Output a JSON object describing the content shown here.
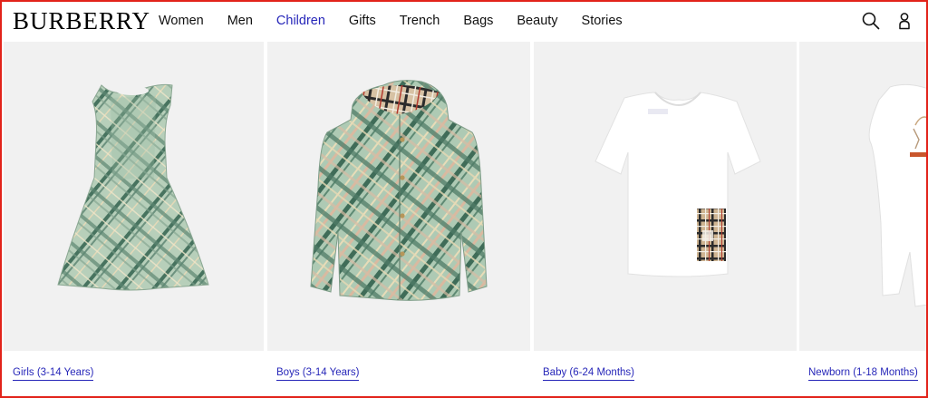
{
  "brand": {
    "logo": "BURBERRY"
  },
  "nav": {
    "items": [
      {
        "label": "Women",
        "active": false
      },
      {
        "label": "Men",
        "active": false
      },
      {
        "label": "Children",
        "active": true
      },
      {
        "label": "Gifts",
        "active": false
      },
      {
        "label": "Trench",
        "active": false
      },
      {
        "label": "Bags",
        "active": false
      },
      {
        "label": "Beauty",
        "active": false
      },
      {
        "label": "Stories",
        "active": false
      }
    ],
    "active_color": "#2727b9"
  },
  "header_icons": {
    "search": "search-icon",
    "account": "account-icon"
  },
  "tiles": [
    {
      "caption": "Girls (3-14 Years)",
      "image": "check-dress"
    },
    {
      "caption": "Boys (3-14 Years)",
      "image": "check-hooded-jacket"
    },
    {
      "caption": "Baby (6-24 Months)",
      "image": "white-tshirt-with-check-pocket"
    },
    {
      "caption": "Newborn (1-18 Months)",
      "image": "white-romper"
    }
  ],
  "colors": {
    "link": "#2727b9",
    "tile_bg": "#f1f1f1",
    "sage": "#a9c6b0",
    "check_dark": "#44715c",
    "beige": "#d6c2a6",
    "frame": "#e2231a"
  }
}
